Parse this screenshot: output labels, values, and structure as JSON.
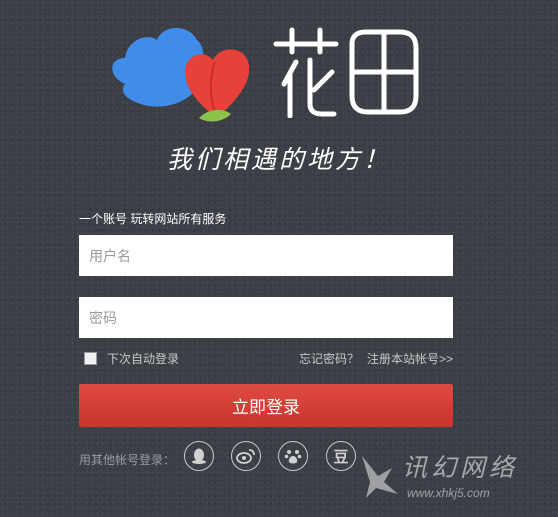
{
  "brand": {
    "name": "花田",
    "slogan": "我们相遇的地方！"
  },
  "login": {
    "subtitle": "一个账号 玩转网站所有服务",
    "username_placeholder": "用户名",
    "password_placeholder": "密码",
    "remember_label": "下次自动登录",
    "forgot_label": "忘记密码？",
    "register_label": "注册本站帐号>>",
    "submit_label": "立即登录"
  },
  "social": {
    "label": "用其他帐号登录：",
    "douban_char": "豆",
    "icons": [
      "qq-icon",
      "weibo-icon",
      "baidu-paw-icon",
      "douban-icon"
    ]
  },
  "watermark": {
    "text": "讯幻网络",
    "url": "www.xhkj5.com"
  },
  "colors": {
    "background": "#3d3f47",
    "button": "#d23d35",
    "petal_blue": "#3f8de8",
    "petal_red": "#e8413a",
    "leaf_green": "#8bc34a"
  }
}
